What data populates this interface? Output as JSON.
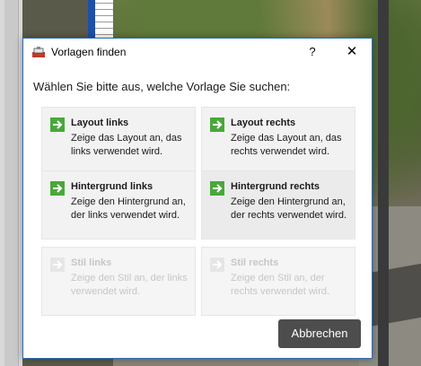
{
  "window": {
    "title": "Vorlagen finden",
    "help_label": "?",
    "close_label": "✕"
  },
  "prompt": "Wählen Sie bitte aus, welche Vorlage Sie suchen:",
  "options": [
    {
      "title": "Layout links",
      "description": "Zeige das Layout an, das links verwendet wird.",
      "enabled": true
    },
    {
      "title": "Layout rechts",
      "description": "Zeige das Layout an, das rechts verwendet wird.",
      "enabled": true
    },
    {
      "title": "Hintergrund links",
      "description": "Zeige den Hintergrund an, der links verwendet wird.",
      "enabled": true
    },
    {
      "title": "Hintergrund rechts",
      "description": "Zeige den Hintergrund an, der rechts verwendet wird.",
      "enabled": true
    },
    {
      "title": "Stil links",
      "description": "Zeige den Stil an, der links verwendet wird.",
      "enabled": false
    },
    {
      "title": "Stil rechts",
      "description": "Zeige den Stil an, der rechts verwendet wird.",
      "enabled": false
    }
  ],
  "cancel_label": "Abbrechen",
  "colors": {
    "accent_green": "#49a83a",
    "dialog_border": "#2d6db5",
    "button_bg": "#4d4d4d"
  },
  "icons": {
    "app": "app-icon",
    "option": "arrow-right-icon"
  }
}
